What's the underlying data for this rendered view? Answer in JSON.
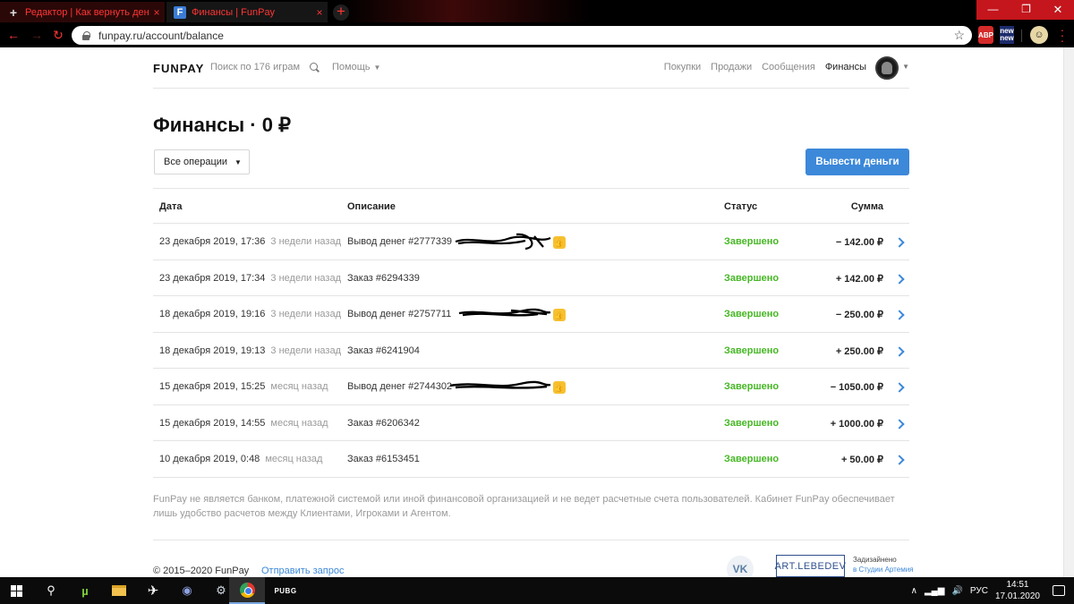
{
  "browser": {
    "tabs": [
      {
        "title": "Редактор | Как вернуть деньги с",
        "close": "×",
        "favicon": "+"
      },
      {
        "title": "Финансы | FunPay",
        "close": "×",
        "favicon": "F"
      }
    ],
    "new_tab": "+",
    "window_controls": {
      "minimize": "—",
      "maximize": "❐",
      "close": "✕"
    },
    "url": "funpay.ru/account/balance",
    "star": "☆",
    "extensions": {
      "abp": "ABP",
      "new_top": "new",
      "new_bottom": "new"
    }
  },
  "header": {
    "logo": "FUNPAY",
    "search_text": "Поиск по 176 играм",
    "help": "Помощь",
    "nav": [
      "Покупки",
      "Продажи",
      "Сообщения",
      "Финансы"
    ]
  },
  "page": {
    "title": "Финансы · 0 ₽",
    "filter": "Все операции",
    "withdraw_button": "Вывести деньги"
  },
  "table": {
    "headers": {
      "date": "Дата",
      "desc": "Описание",
      "status": "Статус",
      "amount": "Сумма"
    },
    "rows": [
      {
        "date": "23 декабря 2019, 17:36",
        "ago": "3 недели назад",
        "desc": "Вывод денег #2777339",
        "status": "Завершено",
        "amount": "− 142.00 ₽"
      },
      {
        "date": "23 декабря 2019, 17:34",
        "ago": "3 недели назад",
        "desc": "Заказ #6294339",
        "status": "Завершено",
        "amount": "+ 142.00 ₽"
      },
      {
        "date": "18 декабря 2019, 19:16",
        "ago": "3 недели назад",
        "desc": "Вывод денег #2757711",
        "status": "Завершено",
        "amount": "− 250.00 ₽"
      },
      {
        "date": "18 декабря 2019, 19:13",
        "ago": "3 недели назад",
        "desc": "Заказ #6241904",
        "status": "Завершено",
        "amount": "+ 250.00 ₽"
      },
      {
        "date": "15 декабря 2019, 15:25",
        "ago": "месяц назад",
        "desc": "Вывод денег #2744302",
        "status": "Завершено",
        "amount": "− 1050.00 ₽"
      },
      {
        "date": "15 декабря 2019, 14:55",
        "ago": "месяц назад",
        "desc": "Заказ #6206342",
        "status": "Завершено",
        "amount": "+ 1000.00 ₽"
      },
      {
        "date": "10 декабря 2019, 0:48",
        "ago": "месяц назад",
        "desc": "Заказ #6153451",
        "status": "Завершено",
        "amount": "+ 50.00 ₽"
      }
    ]
  },
  "note": "FunPay не является банком, платежной системой или иной финансовой организацией и не ведет расчетные счета пользователей. Кабинет FunPay обеспечивает лишь удобство расчетов между Клиентами, Игроками и Агентом.",
  "footer": {
    "copyright": "© 2015–2020 FunPay",
    "report": "Отправить запрос",
    "vk": "VK",
    "studio_logo": "ART.LEBEDEV",
    "designed": "Задизайнено",
    "designed_link": "в Студии Артемия"
  },
  "taskbar": {
    "pubg": "PUBG",
    "lang": "РУС",
    "time": "14:51",
    "date": "17.01.2020"
  }
}
